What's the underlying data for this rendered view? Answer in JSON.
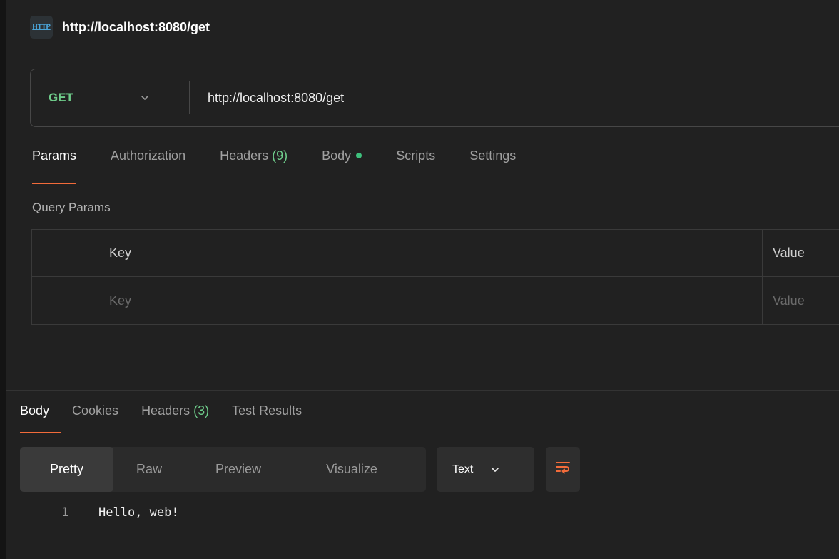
{
  "request": {
    "badge": "HTTP",
    "title": "http://localhost:8080/get",
    "method": "GET",
    "url": "http://localhost:8080/get"
  },
  "request_tabs": [
    {
      "label": "Params",
      "active": true
    },
    {
      "label": "Authorization"
    },
    {
      "label": "Headers",
      "count": "(9)"
    },
    {
      "label": "Body",
      "dot": true
    },
    {
      "label": "Scripts"
    },
    {
      "label": "Settings"
    }
  ],
  "params": {
    "section_label": "Query Params",
    "columns": [
      "Key",
      "Value"
    ],
    "placeholder_key": "Key",
    "placeholder_value": "Value"
  },
  "response_tabs": [
    {
      "label": "Body",
      "active": true
    },
    {
      "label": "Cookies"
    },
    {
      "label": "Headers",
      "count": "(3)"
    },
    {
      "label": "Test Results"
    }
  ],
  "view_modes": [
    {
      "label": "Pretty",
      "active": true
    },
    {
      "label": "Raw"
    },
    {
      "label": "Preview"
    },
    {
      "label": "Visualize"
    }
  ],
  "format": {
    "selected": "Text"
  },
  "response_body": {
    "lines": [
      {
        "number": "1",
        "text": "Hello, web!"
      }
    ]
  },
  "colors": {
    "background": "#212121",
    "method_green": "#6fcd8b",
    "active_underline": "#f26b3a",
    "wrap_icon": "#f26b3a",
    "dot_green": "#3ec07c"
  }
}
